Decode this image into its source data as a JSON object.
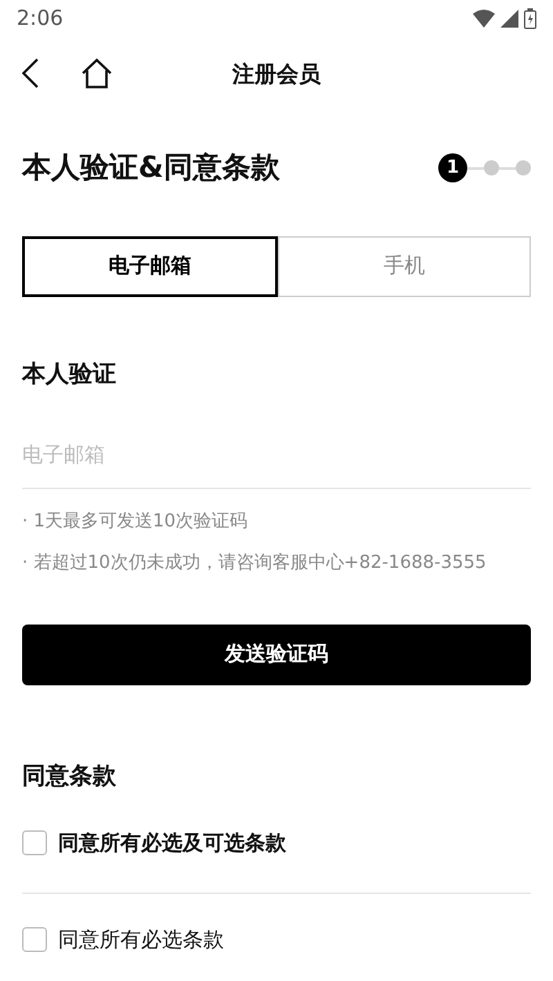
{
  "status_bar": {
    "time": "2:06"
  },
  "header": {
    "title": "注册会员"
  },
  "page_title": "本人验证&同意条款",
  "steps": [
    {
      "label": "1",
      "selected": true
    },
    {
      "selected": false
    },
    {
      "selected": false
    }
  ],
  "tabs": [
    {
      "label": "电子邮箱",
      "selected": true
    },
    {
      "label": "手机",
      "selected": false
    }
  ],
  "verify": {
    "heading": "本人验证",
    "email_field": {
      "placeholder": "电子邮箱"
    },
    "notes": [
      "· 1天最多可发送10次验证码",
      "· 若超过10次仍未成功，请咨询客服中心+82-1688-3555"
    ],
    "button": "发送验证码"
  },
  "terms": {
    "heading": "同意条款",
    "items": [
      {
        "kind": "master",
        "label": "同意所有必选及可选条款",
        "checked": false
      },
      {
        "kind": "item",
        "label": "同意所有必选条款",
        "checked": false
      }
    ]
  }
}
